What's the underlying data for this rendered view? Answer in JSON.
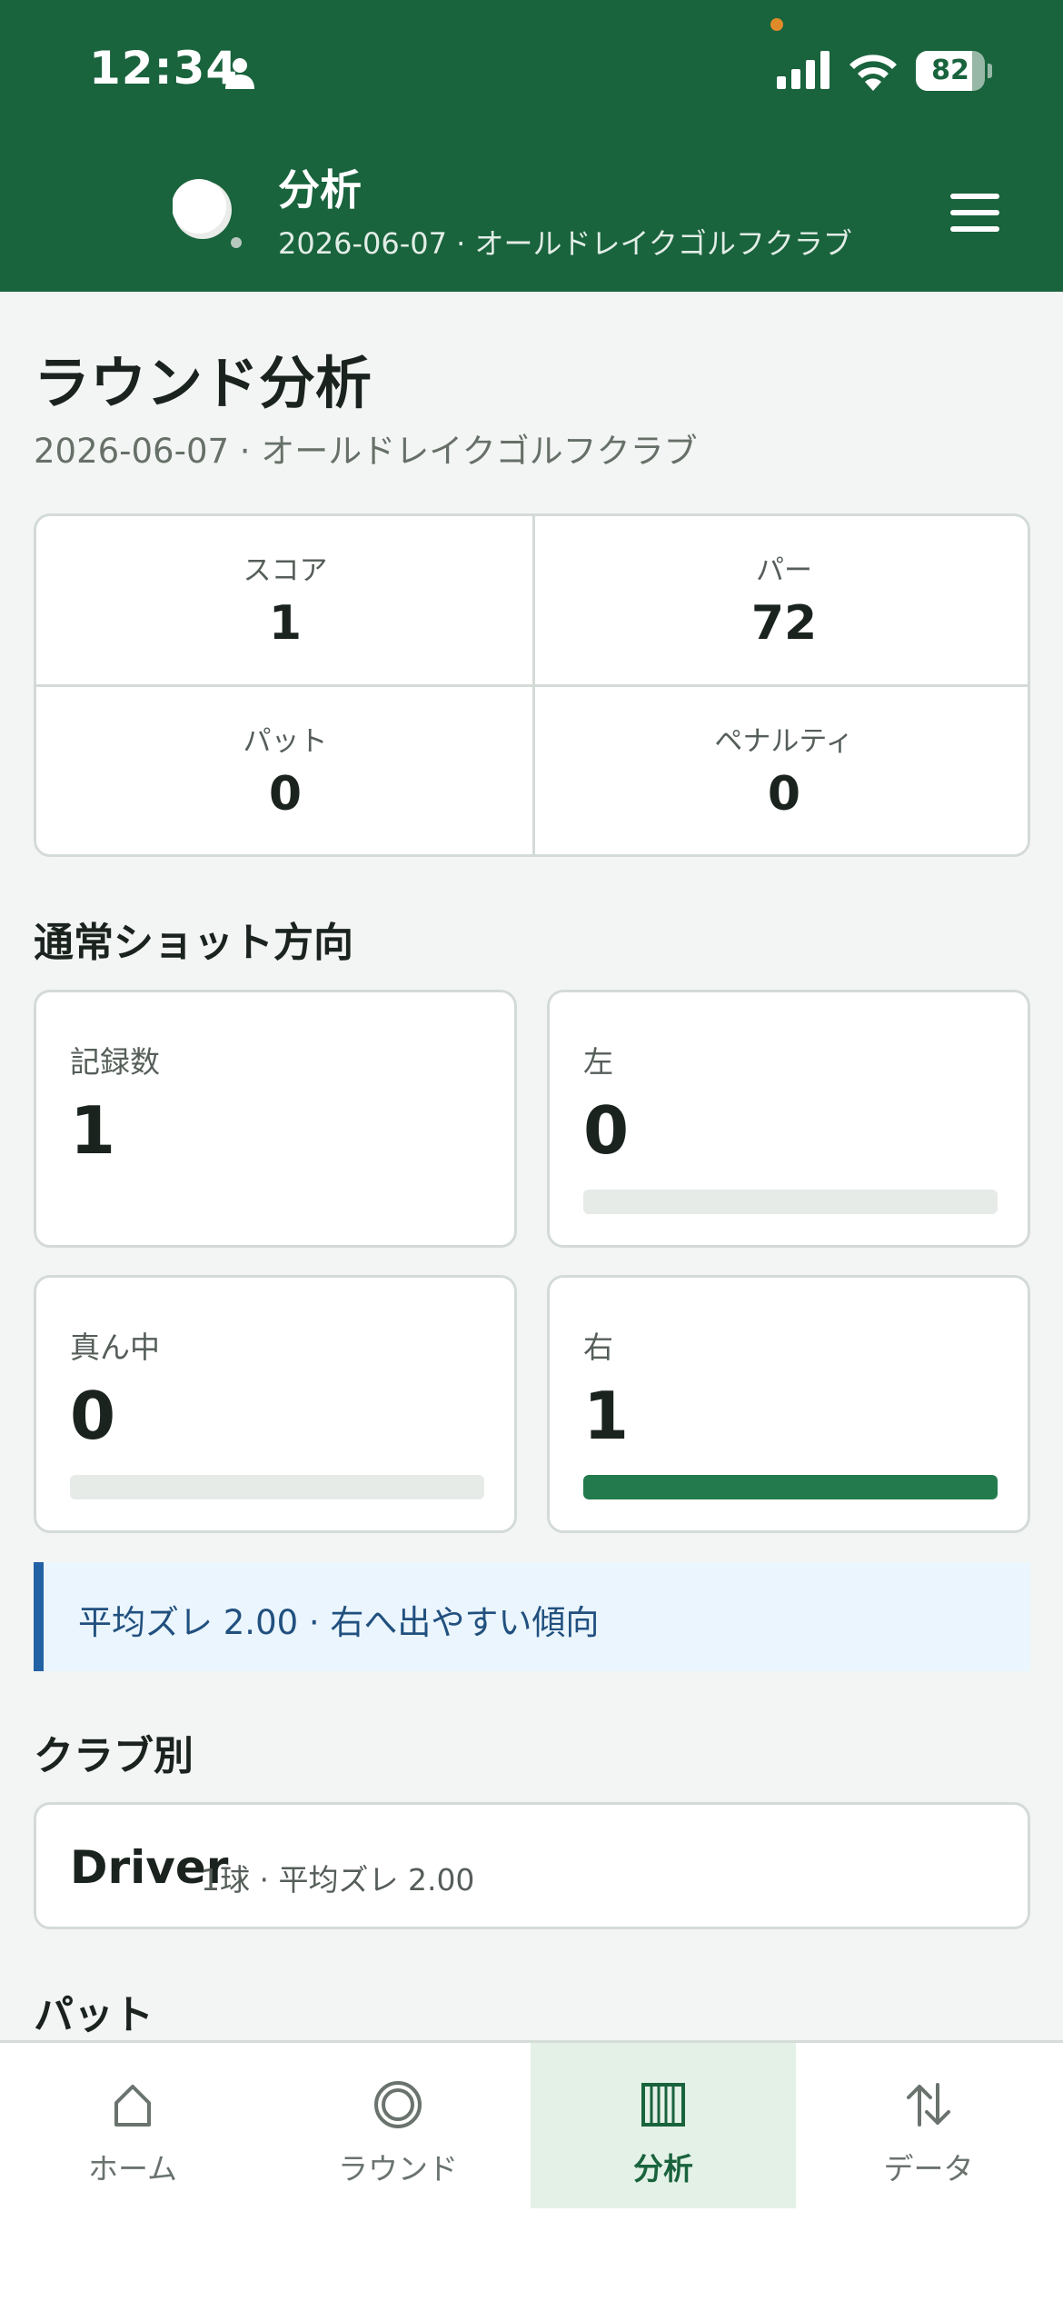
{
  "status_bar": {
    "time": "12:34",
    "battery": "82",
    "battery_level": 0.82
  },
  "header": {
    "title": "分析",
    "subtitle": "2026-06-07 · オールドレイクゴルフクラブ"
  },
  "page": {
    "title": "ラウンド分析",
    "subtitle": "2026-06-07 · オールドレイクゴルフクラブ"
  },
  "summary": [
    {
      "label": "スコア",
      "value": "1"
    },
    {
      "label": "パー",
      "value": "72"
    },
    {
      "label": "パット",
      "value": "0"
    },
    {
      "label": "ペナルティ",
      "value": "0"
    }
  ],
  "direction": {
    "title": "通常ショット方向",
    "count": {
      "label": "記録数",
      "value": "1"
    },
    "left": {
      "label": "左",
      "value": "0",
      "share": 0
    },
    "center": {
      "label": "真ん中",
      "value": "0",
      "share": 0
    },
    "right": {
      "label": "右",
      "value": "1",
      "share": 1
    }
  },
  "insight": "平均ズレ 2.00 · 右へ出やすい傾向",
  "clubs": {
    "title": "クラブ別",
    "items": [
      {
        "name": "Driver",
        "meta": "1球 · 平均ズレ 2.00"
      }
    ]
  },
  "putt": {
    "title": "パット"
  },
  "nav": [
    {
      "label": "ホーム",
      "icon": "home-icon",
      "active": false
    },
    {
      "label": "ラウンド",
      "icon": "round-icon",
      "active": false
    },
    {
      "label": "分析",
      "icon": "analysis-icon",
      "active": true
    },
    {
      "label": "データ",
      "icon": "data-transfer-icon",
      "active": false
    }
  ],
  "colors": {
    "brand": "#19633d",
    "accent_bar": "#237a4c",
    "insight_border": "#2262a4",
    "insight_bg": "#eaf5fd"
  }
}
